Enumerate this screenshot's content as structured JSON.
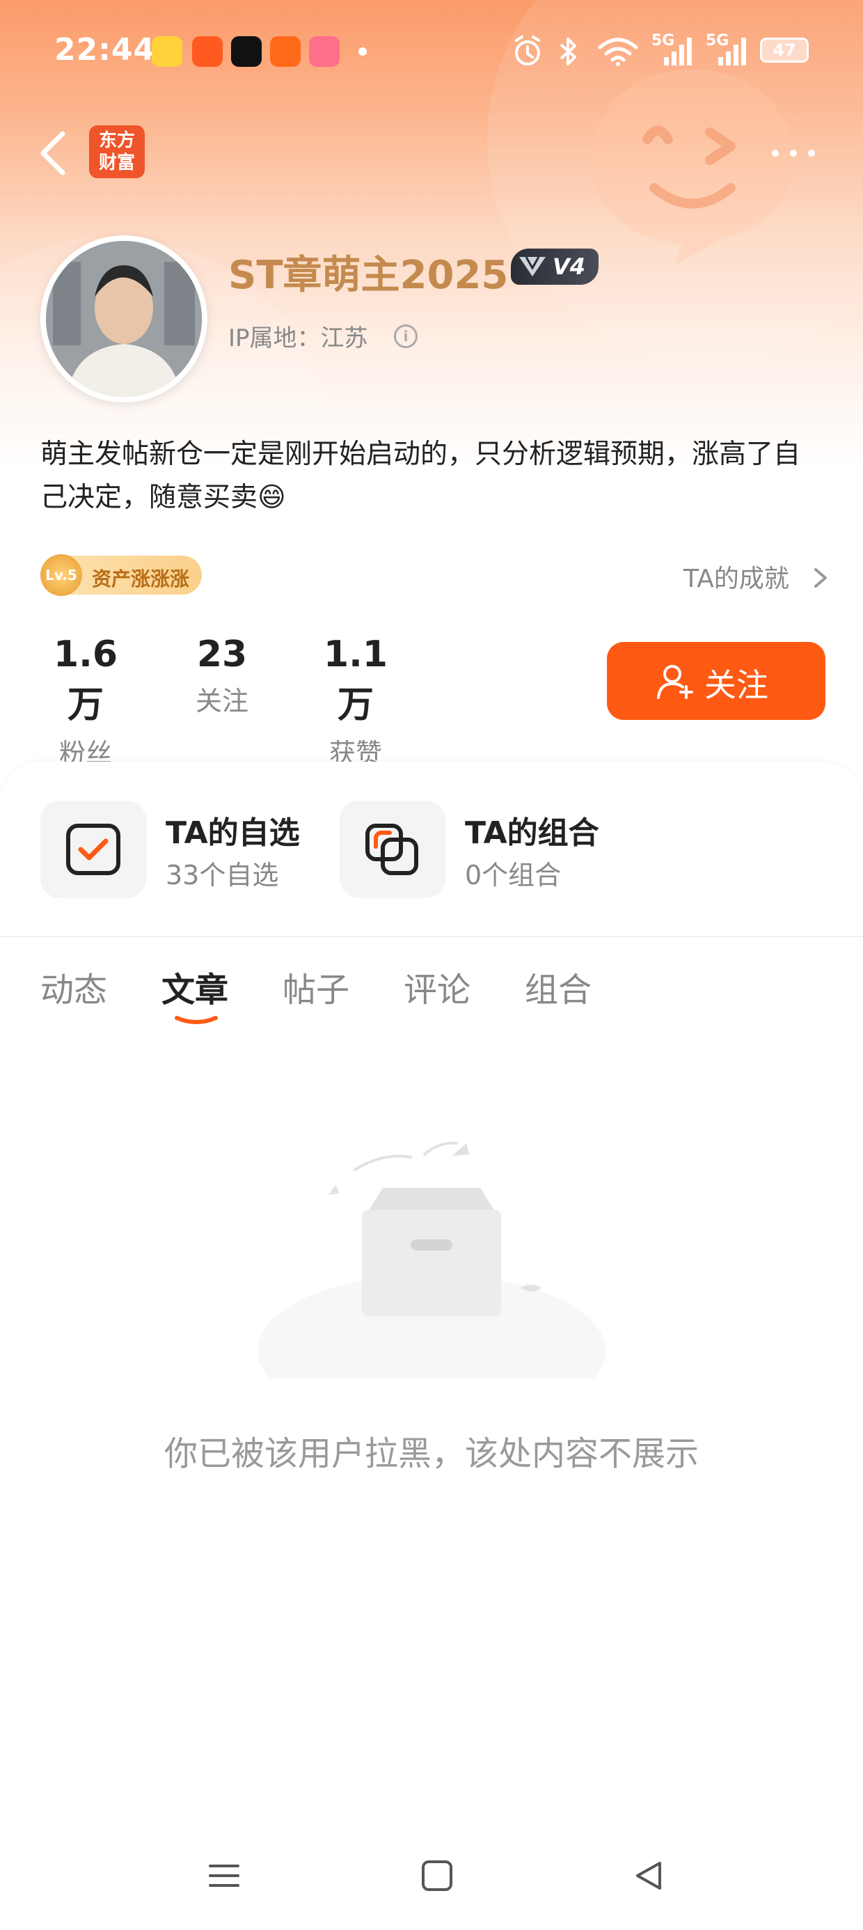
{
  "status_bar": {
    "time": "22:44",
    "net1": "5G",
    "net2": "5G",
    "battery": "47"
  },
  "header": {
    "logo_line1": "东方",
    "logo_line2": "财富"
  },
  "profile": {
    "username": "ST章萌主2025",
    "vip_badge": "V4",
    "ip_location": "IP属地：江苏",
    "bio": "萌主发帖新仓一定是刚开始启动的，只分析逻辑预期，涨高了自己决定，随意买卖😄",
    "level_badge_coin": "Lv.5",
    "level_badge_text": "资产涨涨涨",
    "achievements_link": "TA的成就"
  },
  "stats": [
    {
      "value": "1.6万",
      "label": "粉丝"
    },
    {
      "value": "23",
      "label": "关注"
    },
    {
      "value": "1.1万",
      "label": "获赞"
    }
  ],
  "follow_button": "关注",
  "entries": [
    {
      "title": "TA的自选",
      "subtitle": "33个自选"
    },
    {
      "title": "TA的组合",
      "subtitle": "0个组合"
    }
  ],
  "tabs": [
    {
      "label": "动态"
    },
    {
      "label": "文章",
      "active": true
    },
    {
      "label": "帖子"
    },
    {
      "label": "评论"
    },
    {
      "label": "组合"
    }
  ],
  "empty_message": "你已被该用户拉黑，该处内容不展示",
  "colors": {
    "accent": "#fe5a14",
    "username": "#c48a4e"
  },
  "icons": {
    "back": "back-arrow-icon",
    "more": "more-dots-icon",
    "info": "info-icon",
    "chevron": "chevron-right-icon",
    "follow": "add-person-icon",
    "watchlist": "checkbox-icon",
    "portfolio": "overlap-squares-icon"
  }
}
